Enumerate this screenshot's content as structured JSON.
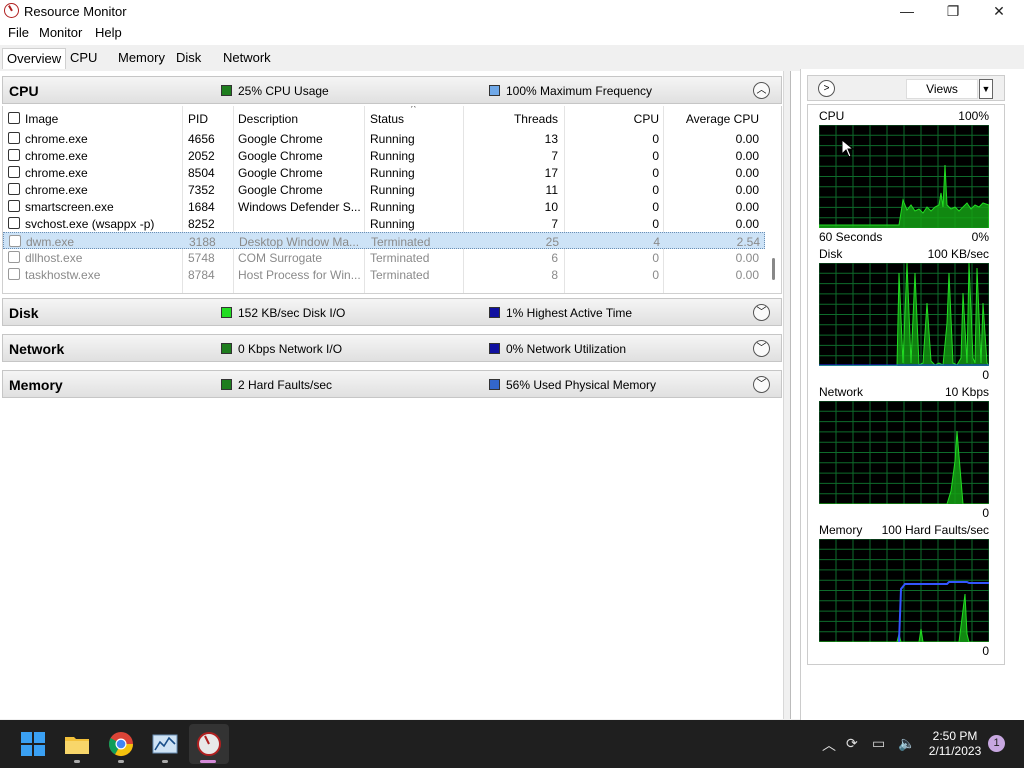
{
  "window": {
    "title": "Resource Monitor",
    "min": "—",
    "max": "❐",
    "close": "✕"
  },
  "menu": [
    "File",
    "Monitor",
    "Help"
  ],
  "tabs": [
    "Overview",
    "CPU",
    "Memory",
    "Disk",
    "Network"
  ],
  "cpu_section": {
    "title": "CPU",
    "stat1": "25% CPU Usage",
    "stat2": "100% Maximum Frequency",
    "columns": [
      "Image",
      "PID",
      "Description",
      "Status",
      "Threads",
      "CPU",
      "Average CPU"
    ],
    "rows": [
      {
        "image": "chrome.exe",
        "pid": "4656",
        "desc": "Google Chrome",
        "status": "Running",
        "threads": "13",
        "cpu": "0",
        "avg": "0.00"
      },
      {
        "image": "chrome.exe",
        "pid": "2052",
        "desc": "Google Chrome",
        "status": "Running",
        "threads": "7",
        "cpu": "0",
        "avg": "0.00"
      },
      {
        "image": "chrome.exe",
        "pid": "8504",
        "desc": "Google Chrome",
        "status": "Running",
        "threads": "17",
        "cpu": "0",
        "avg": "0.00"
      },
      {
        "image": "chrome.exe",
        "pid": "7352",
        "desc": "Google Chrome",
        "status": "Running",
        "threads": "11",
        "cpu": "0",
        "avg": "0.00"
      },
      {
        "image": "smartscreen.exe",
        "pid": "1684",
        "desc": "Windows Defender S...",
        "status": "Running",
        "threads": "10",
        "cpu": "0",
        "avg": "0.00"
      },
      {
        "image": "svchost.exe (wsappx -p)",
        "pid": "8252",
        "desc": "",
        "status": "Running",
        "threads": "7",
        "cpu": "0",
        "avg": "0.00"
      },
      {
        "image": "dwm.exe",
        "pid": "3188",
        "desc": "Desktop Window Ma...",
        "status": "Terminated",
        "threads": "25",
        "cpu": "4",
        "avg": "2.54"
      },
      {
        "image": "dllhost.exe",
        "pid": "5748",
        "desc": "COM Surrogate",
        "status": "Terminated",
        "threads": "6",
        "cpu": "0",
        "avg": "0.00"
      },
      {
        "image": "taskhostw.exe",
        "pid": "8784",
        "desc": "Host Process for Win...",
        "status": "Terminated",
        "threads": "8",
        "cpu": "0",
        "avg": "0.00"
      }
    ]
  },
  "disk_section": {
    "title": "Disk",
    "stat1": "152 KB/sec Disk I/O",
    "stat2": "1% Highest Active Time"
  },
  "network_section": {
    "title": "Network",
    "stat1": "0 Kbps Network I/O",
    "stat2": "0% Network Utilization"
  },
  "memory_section": {
    "title": "Memory",
    "stat1": "2 Hard Faults/sec",
    "stat2": "56% Used Physical Memory"
  },
  "right_pane": {
    "views_label": "Views",
    "cpu_graph": {
      "label": "CPU",
      "max": "100%",
      "footer_left": "60 Seconds",
      "footer_right": "0%"
    },
    "disk_graph": {
      "label": "Disk",
      "max": "100 KB/sec",
      "min": "0"
    },
    "network_graph": {
      "label": "Network",
      "max": "10 Kbps",
      "min": "0"
    },
    "memory_graph": {
      "label": "Memory",
      "max": "100 Hard Faults/sec",
      "min": "0"
    }
  },
  "taskbar": {
    "time": "2:50 PM",
    "date": "2/11/2023",
    "notification_count": "1"
  },
  "colors": {
    "cpu_usage": "#1e7d1e",
    "max_frequency": "#6fa8e8",
    "disk_io": "#22dd22",
    "highest_active": "#1010a0",
    "network_io": "#1e7d1e",
    "network_util": "#1010a0",
    "hard_faults": "#1e7d1e",
    "used_memory": "#3366cc",
    "graph_line": "#22dd22",
    "graph_grid": "#0e6b2b"
  }
}
